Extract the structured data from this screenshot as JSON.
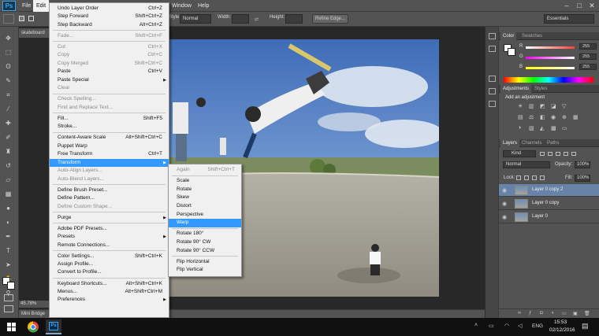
{
  "menubar": {
    "logo": "Ps",
    "items": [
      "File",
      "Edit",
      "Window",
      "Help"
    ],
    "window_controls": [
      "–",
      "□",
      "✕"
    ]
  },
  "options": {
    "style_label": "Style:",
    "style_value": "Normal",
    "width_label": "Width:",
    "height_label": "Height:",
    "refine_edge": "Refine Edge...",
    "workspace": "Essentials"
  },
  "document": {
    "tab": "skateboard",
    "zoom": "45.78%",
    "mini_bridge": "Mini Bridge"
  },
  "edit_menu": [
    {
      "label": "Undo Layer Order",
      "shortcut": "Ctrl+Z",
      "state": "enabled"
    },
    {
      "label": "Step Forward",
      "shortcut": "Shift+Ctrl+Z",
      "state": "enabled"
    },
    {
      "label": "Step Backward",
      "shortcut": "Alt+Ctrl+Z",
      "state": "enabled"
    },
    {
      "sep": true
    },
    {
      "label": "Fade...",
      "shortcut": "Shift+Ctrl+F",
      "state": "disabled"
    },
    {
      "sep": true
    },
    {
      "label": "Cut",
      "shortcut": "Ctrl+X",
      "state": "disabled"
    },
    {
      "label": "Copy",
      "shortcut": "Ctrl+C",
      "state": "disabled"
    },
    {
      "label": "Copy Merged",
      "shortcut": "Shift+Ctrl+C",
      "state": "disabled"
    },
    {
      "label": "Paste",
      "shortcut": "Ctrl+V",
      "state": "enabled"
    },
    {
      "label": "Paste Special",
      "shortcut": "",
      "state": "enabled",
      "submenu": true
    },
    {
      "label": "Clear",
      "shortcut": "",
      "state": "disabled"
    },
    {
      "sep": true
    },
    {
      "label": "Check Spelling...",
      "shortcut": "",
      "state": "disabled"
    },
    {
      "label": "Find and Replace Text...",
      "shortcut": "",
      "state": "disabled"
    },
    {
      "sep": true
    },
    {
      "label": "Fill...",
      "shortcut": "Shift+F5",
      "state": "enabled"
    },
    {
      "label": "Stroke...",
      "shortcut": "",
      "state": "enabled"
    },
    {
      "sep": true
    },
    {
      "label": "Content-Aware Scale",
      "shortcut": "Alt+Shift+Ctrl+C",
      "state": "enabled"
    },
    {
      "label": "Puppet Warp",
      "shortcut": "",
      "state": "enabled"
    },
    {
      "label": "Free Transform",
      "shortcut": "Ctrl+T",
      "state": "enabled"
    },
    {
      "label": "Transform",
      "shortcut": "",
      "state": "highlighted",
      "submenu": true
    },
    {
      "label": "Auto-Align Layers...",
      "shortcut": "",
      "state": "disabled"
    },
    {
      "label": "Auto-Blend Layers...",
      "shortcut": "",
      "state": "disabled"
    },
    {
      "sep": true
    },
    {
      "label": "Define Brush Preset...",
      "shortcut": "",
      "state": "enabled"
    },
    {
      "label": "Define Pattern...",
      "shortcut": "",
      "state": "enabled"
    },
    {
      "label": "Define Custom Shape...",
      "shortcut": "",
      "state": "disabled"
    },
    {
      "sep": true
    },
    {
      "label": "Purge",
      "shortcut": "",
      "state": "enabled",
      "submenu": true
    },
    {
      "sep": true
    },
    {
      "label": "Adobe PDF Presets...",
      "shortcut": "",
      "state": "enabled"
    },
    {
      "label": "Presets",
      "shortcut": "",
      "state": "enabled",
      "submenu": true
    },
    {
      "label": "Remote Connections...",
      "shortcut": "",
      "state": "enabled"
    },
    {
      "sep": true
    },
    {
      "label": "Color Settings...",
      "shortcut": "Shift+Ctrl+K",
      "state": "enabled"
    },
    {
      "label": "Assign Profile...",
      "shortcut": "",
      "state": "enabled"
    },
    {
      "label": "Convert to Profile...",
      "shortcut": "",
      "state": "enabled"
    },
    {
      "sep": true
    },
    {
      "label": "Keyboard Shortcuts...",
      "shortcut": "Alt+Shift+Ctrl+K",
      "state": "enabled"
    },
    {
      "label": "Menus...",
      "shortcut": "Alt+Shift+Ctrl+M",
      "state": "enabled"
    },
    {
      "label": "Preferences",
      "shortcut": "",
      "state": "enabled",
      "submenu": true
    }
  ],
  "transform_menu": [
    {
      "label": "Again",
      "shortcut": "Shift+Ctrl+T",
      "state": "disabled"
    },
    {
      "sep": true
    },
    {
      "label": "Scale",
      "shortcut": "",
      "state": "enabled"
    },
    {
      "label": "Rotate",
      "shortcut": "",
      "state": "enabled"
    },
    {
      "label": "Skew",
      "shortcut": "",
      "state": "enabled"
    },
    {
      "label": "Distort",
      "shortcut": "",
      "state": "enabled"
    },
    {
      "label": "Perspective",
      "shortcut": "",
      "state": "enabled"
    },
    {
      "label": "Warp",
      "shortcut": "",
      "state": "highlighted"
    },
    {
      "sep": true
    },
    {
      "label": "Rotate 180°",
      "shortcut": "",
      "state": "enabled"
    },
    {
      "label": "Rotate 90° CW",
      "shortcut": "",
      "state": "enabled"
    },
    {
      "label": "Rotate 90° CCW",
      "shortcut": "",
      "state": "enabled"
    },
    {
      "sep": true
    },
    {
      "label": "Flip Horizontal",
      "shortcut": "",
      "state": "enabled"
    },
    {
      "label": "Flip Vertical",
      "shortcut": "",
      "state": "enabled"
    }
  ],
  "color_panel": {
    "tabs": [
      "Color",
      "Swatches"
    ],
    "channels": [
      {
        "name": "R",
        "value": "255",
        "color": "#ff4040"
      },
      {
        "name": "G",
        "value": "255",
        "color": "#40ff40"
      },
      {
        "name": "B",
        "value": "255",
        "color": "#4060ff"
      }
    ]
  },
  "adjustments_panel": {
    "tabs": [
      "Adjustments",
      "Styles"
    ],
    "heading": "Add an adjustment"
  },
  "layers_panel": {
    "tabs": [
      "Layers",
      "Channels",
      "Paths"
    ],
    "kind": "Kind",
    "blend_mode": "Normal",
    "opacity_label": "Opacity:",
    "opacity_value": "100%",
    "lock_label": "Lock:",
    "fill_label": "Fill:",
    "fill_value": "100%",
    "layers": [
      {
        "name": "Layer 0 copy 2",
        "selected": true
      },
      {
        "name": "Layer 0 copy",
        "selected": false
      },
      {
        "name": "Layer 0",
        "selected": false
      }
    ]
  },
  "taskbar": {
    "language": "ENG",
    "time": "15:53",
    "date": "02/12/2016"
  },
  "colors": {
    "ui_gray": "#535353",
    "highlight": "#3399ff",
    "layer_selected": "#6783a8"
  }
}
